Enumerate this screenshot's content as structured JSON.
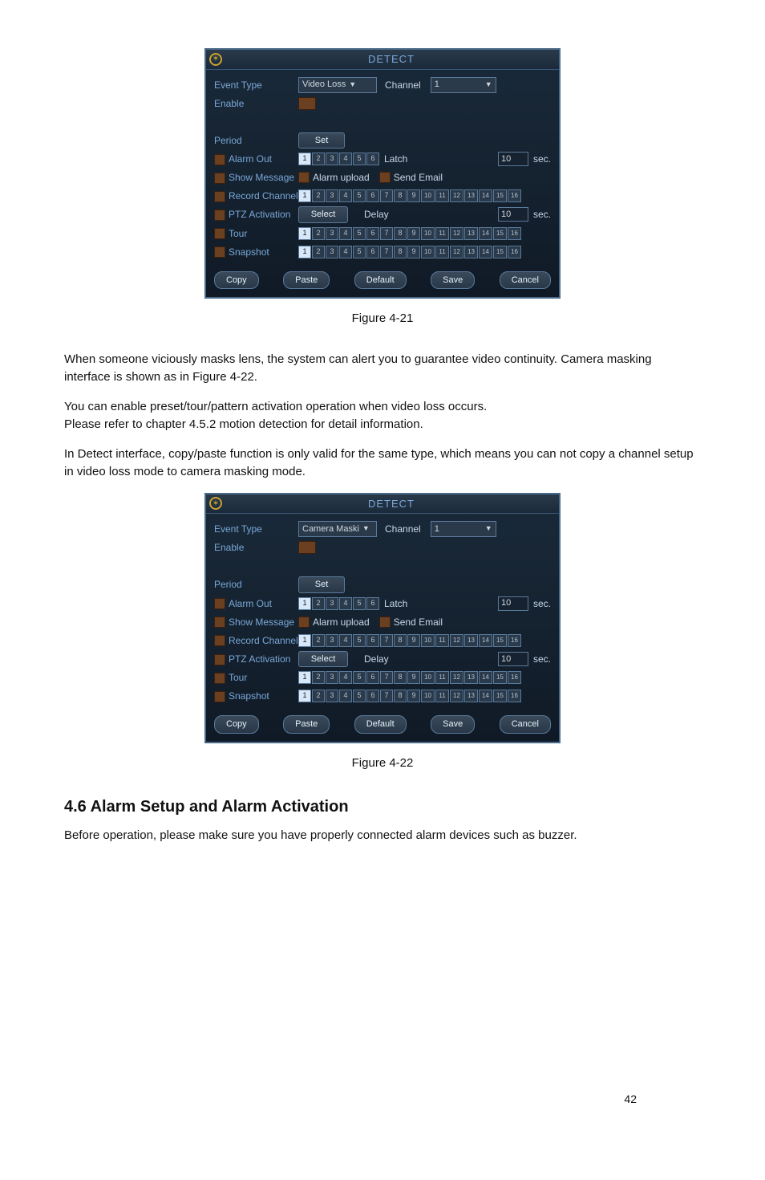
{
  "figure1": {
    "title": "DETECT",
    "event_type_label": "Event Type",
    "event_type_value": "Video Loss",
    "channel_label": "Channel",
    "channel_value": "1",
    "enable_label": "Enable",
    "period_label": "Period",
    "set_btn": "Set",
    "alarm_out_label": "Alarm Out",
    "latch_label": "Latch",
    "latch_value": "10",
    "latch_unit": "sec.",
    "show_message_label": "Show Message",
    "alarm_upload_label": "Alarm upload",
    "send_email_label": "Send Email",
    "record_channel_label": "Record Channel",
    "ptz_label": "PTZ Activation",
    "ptz_select_btn": "Select",
    "delay_label": "Delay",
    "delay_value": "10",
    "delay_unit": "sec.",
    "tour_label": "Tour",
    "snapshot_label": "Snapshot",
    "copy_btn": "Copy",
    "paste_btn": "Paste",
    "default_btn": "Default",
    "save_btn": "Save",
    "cancel_btn": "Cancel",
    "caption": "Figure 4-21"
  },
  "body_text": {
    "p1": "When someone viciously masks lens, the system can alert you to guarantee video continuity. Camera masking interface is shown as in Figure 4-22.",
    "p2a": "You can enable preset/tour/pattern activation operation when video loss occurs.",
    "p2b": "Please refer to chapter 4.5.2 motion detection for detail information.",
    "p3": "In Detect interface, copy/paste function is only valid for the same type, which means you can not copy a channel setup in video loss mode to camera masking mode."
  },
  "figure2": {
    "title": "DETECT",
    "event_type_label": "Event Type",
    "event_type_value": "Camera Maski",
    "channel_label": "Channel",
    "channel_value": "1",
    "enable_label": "Enable",
    "period_label": "Period",
    "set_btn": "Set",
    "alarm_out_label": "Alarm Out",
    "latch_label": "Latch",
    "latch_value": "10",
    "latch_unit": "sec.",
    "show_message_label": "Show Message",
    "alarm_upload_label": "Alarm upload",
    "send_email_label": "Send Email",
    "record_channel_label": "Record Channel",
    "ptz_label": "PTZ Activation",
    "ptz_select_btn": "Select",
    "delay_label": "Delay",
    "delay_value": "10",
    "delay_unit": "sec.",
    "tour_label": "Tour",
    "snapshot_label": "Snapshot",
    "copy_btn": "Copy",
    "paste_btn": "Paste",
    "default_btn": "Default",
    "save_btn": "Save",
    "cancel_btn": "Cancel",
    "caption": "Figure 4-22"
  },
  "section": {
    "heading": "4.6  Alarm Setup and Alarm Activation",
    "p": "Before operation, please make sure you have properly connected alarm devices such as buzzer."
  },
  "page_number": "42"
}
